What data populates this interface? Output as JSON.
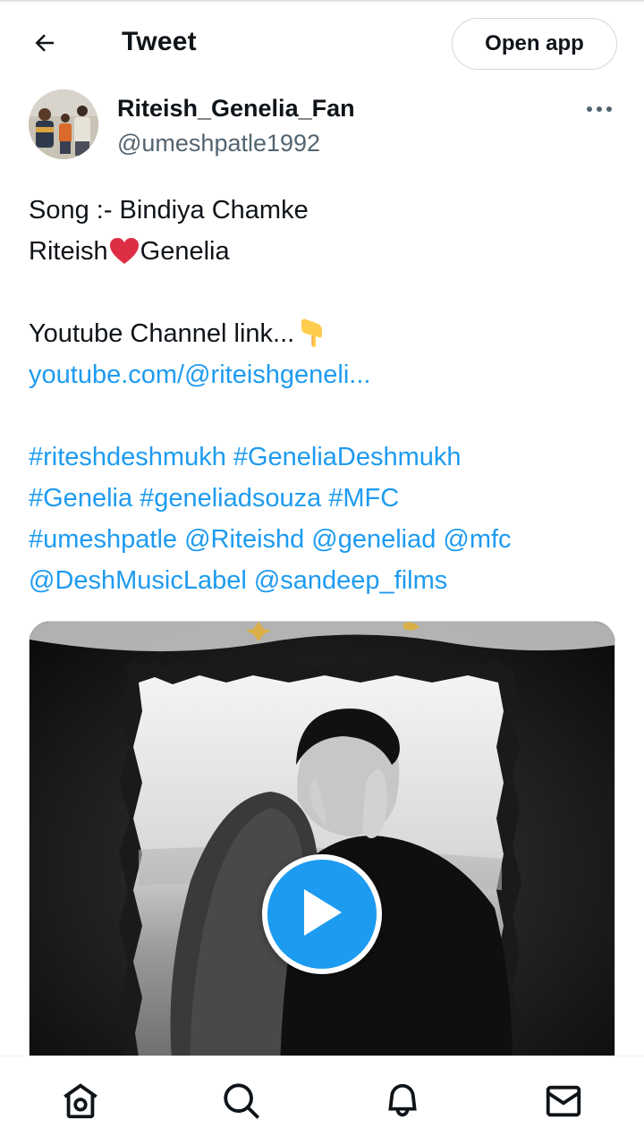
{
  "header": {
    "title": "Tweet",
    "open_app_label": "Open app",
    "back_icon": "arrow-left-icon"
  },
  "author": {
    "display_name": "Riteish_Genelia_Fan",
    "handle": "@umeshpatle1992",
    "more_icon": "more-horizontal-icon"
  },
  "tweet": {
    "line1": "Song :- Bindiya Chamke",
    "line2_a": "Riteish",
    "line2_emoji": "red-heart",
    "line2_b": "Genelia",
    "line3": "Youtube Channel link...",
    "line3_emoji": "backhand-index-pointing-down",
    "youtube_link": "youtube.com/@riteishgeneli...",
    "tags_row1": [
      "#riteshdeshmukh",
      "#GeneliaDeshmukh"
    ],
    "tags_row2": [
      "#Genelia",
      "#geneliadsouza",
      "#MFC"
    ],
    "tags_row3": [
      "#umeshpatle",
      "@Riteishd",
      "@geneliad",
      "@mfc"
    ],
    "tags_row4": [
      "@DeshMusicLabel",
      "@sandeep_films"
    ]
  },
  "media": {
    "type": "video",
    "play_icon": "play-icon"
  },
  "bottom_nav": {
    "items": [
      "home-icon",
      "search-icon",
      "notifications-bell-icon",
      "messages-envelope-icon"
    ]
  },
  "colors": {
    "link": "#1d9bf0",
    "text": "#0f1419",
    "secondary": "#536471",
    "border": "#cfd9de"
  }
}
